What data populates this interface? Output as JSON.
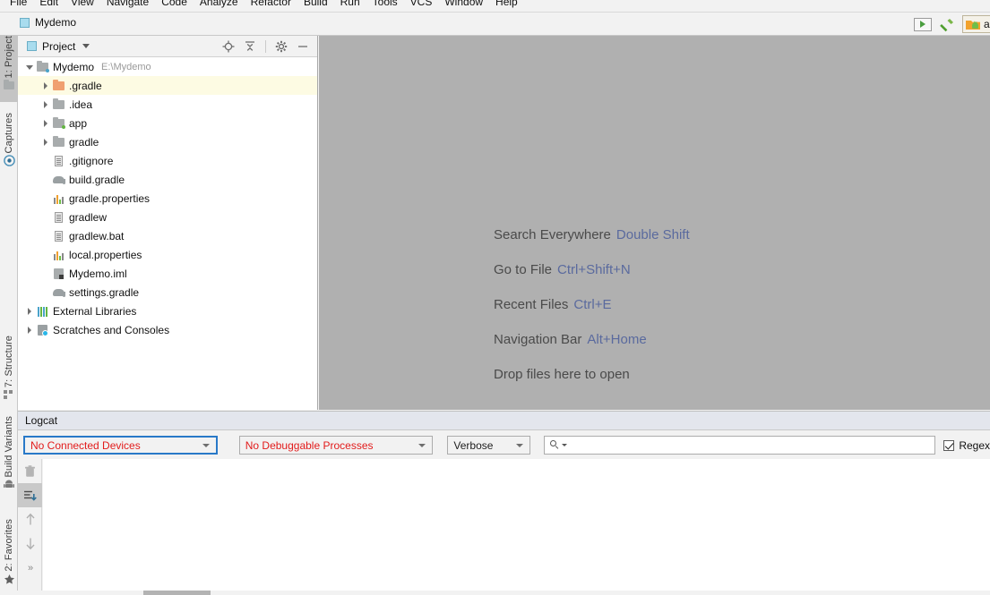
{
  "menu": {
    "items": [
      {
        "label": "File",
        "mnemonic": "F"
      },
      {
        "label": "Edit",
        "mnemonic": "E"
      },
      {
        "label": "View",
        "mnemonic": "V"
      },
      {
        "label": "Navigate",
        "mnemonic": "N"
      },
      {
        "label": "Code",
        "mnemonic": "C"
      },
      {
        "label": "Analyze",
        "mnemonic": "z"
      },
      {
        "label": "Refactor",
        "mnemonic": "R"
      },
      {
        "label": "Build",
        "mnemonic": "B"
      },
      {
        "label": "Run",
        "mnemonic": "u"
      },
      {
        "label": "Tools",
        "mnemonic": "T"
      },
      {
        "label": "VCS",
        "mnemonic": "S"
      },
      {
        "label": "Window",
        "mnemonic": "W"
      },
      {
        "label": "Help",
        "mnemonic": "H"
      }
    ]
  },
  "toolbar": {
    "project_name": "Mydemo",
    "run_config_icon": "run-triangle-icon",
    "build_icon": "hammer-icon",
    "module_chip_label": "app",
    "module_chip_icon": "android-module-icon"
  },
  "left_strip": {
    "top_buttons": [
      {
        "label": "1: Project",
        "icon": "project-folder-icon",
        "active": true
      },
      {
        "label": "Captures",
        "icon": "captures-target-icon",
        "active": false
      }
    ],
    "bottom_buttons": [
      {
        "label": "7: Structure",
        "icon": "structure-icon",
        "active": false
      },
      {
        "label": "Build Variants",
        "icon": "android-icon",
        "active": false
      },
      {
        "label": "2: Favorites",
        "icon": "star-icon",
        "active": false
      }
    ]
  },
  "project_panel": {
    "title": "Project",
    "title_icon": "project-square-icon",
    "actions": [
      {
        "name": "locate-icon"
      },
      {
        "name": "collapse-all-icon"
      },
      {
        "name": "gear-icon"
      },
      {
        "name": "minimize-icon"
      }
    ],
    "tree": [
      {
        "label": "Mydemo",
        "detail": "E:\\Mydemo",
        "indent": 0,
        "arrow": "open",
        "icon": "module-folder-icon",
        "highlight": false
      },
      {
        "label": ".gradle",
        "detail": "",
        "indent": 1,
        "arrow": "closed",
        "icon": "folder-orange-icon",
        "highlight": true
      },
      {
        "label": ".idea",
        "detail": "",
        "indent": 1,
        "arrow": "closed",
        "icon": "folder-grey-icon",
        "highlight": false
      },
      {
        "label": "app",
        "detail": "",
        "indent": 1,
        "arrow": "closed",
        "icon": "folder-module-icon",
        "highlight": false
      },
      {
        "label": "gradle",
        "detail": "",
        "indent": 1,
        "arrow": "closed",
        "icon": "folder-grey-icon",
        "highlight": false
      },
      {
        "label": ".gitignore",
        "detail": "",
        "indent": 1,
        "arrow": "none",
        "icon": "text-file-icon",
        "highlight": false
      },
      {
        "label": "build.gradle",
        "detail": "",
        "indent": 1,
        "arrow": "none",
        "icon": "gradle-file-icon",
        "highlight": false
      },
      {
        "label": "gradle.properties",
        "detail": "",
        "indent": 1,
        "arrow": "none",
        "icon": "properties-file-icon",
        "highlight": false
      },
      {
        "label": "gradlew",
        "detail": "",
        "indent": 1,
        "arrow": "none",
        "icon": "text-file-icon",
        "highlight": false
      },
      {
        "label": "gradlew.bat",
        "detail": "",
        "indent": 1,
        "arrow": "none",
        "icon": "text-file-icon",
        "highlight": false
      },
      {
        "label": "local.properties",
        "detail": "",
        "indent": 1,
        "arrow": "none",
        "icon": "properties-file-icon",
        "highlight": false
      },
      {
        "label": "Mydemo.iml",
        "detail": "",
        "indent": 1,
        "arrow": "none",
        "icon": "iml-file-icon",
        "highlight": false
      },
      {
        "label": "settings.gradle",
        "detail": "",
        "indent": 1,
        "arrow": "none",
        "icon": "gradle-file-icon",
        "highlight": false
      },
      {
        "label": "External Libraries",
        "detail": "",
        "indent": 0,
        "arrow": "closed",
        "icon": "library-icon",
        "highlight": false
      },
      {
        "label": "Scratches and Consoles",
        "detail": "",
        "indent": 0,
        "arrow": "closed",
        "icon": "scratches-icon",
        "highlight": false
      }
    ]
  },
  "editor": {
    "hints": [
      {
        "action": "Search Everywhere",
        "shortcut": "Double Shift"
      },
      {
        "action": "Go to File",
        "shortcut": "Ctrl+Shift+N"
      },
      {
        "action": "Recent Files",
        "shortcut": "Ctrl+E"
      },
      {
        "action": "Navigation Bar",
        "shortcut": "Alt+Home"
      },
      {
        "action": "Drop files here to open",
        "shortcut": ""
      }
    ]
  },
  "logcat": {
    "tab_label": "Logcat",
    "device_select": {
      "value": "No Connected Devices",
      "state": "error",
      "focused": true
    },
    "process_select": {
      "value": "No Debuggable Processes",
      "state": "error",
      "focused": false
    },
    "level_select": {
      "value": "Verbose",
      "state": "normal",
      "focused": false
    },
    "search": {
      "value": "",
      "placeholder": "",
      "icon": "search-icon"
    },
    "regex": {
      "label": "Regex",
      "checked": true
    },
    "side_buttons": [
      {
        "name": "clear-logcat-icon",
        "selected": false
      },
      {
        "name": "scroll-to-end-icon",
        "selected": true
      },
      {
        "name": "up-arrow-icon",
        "selected": false
      },
      {
        "name": "down-arrow-icon",
        "selected": false
      },
      {
        "name": "expand-more-icon",
        "selected": false
      }
    ],
    "content": ""
  },
  "colors": {
    "accent_blue": "#2979c8",
    "error_red": "#e21b1b",
    "shortcut_blue": "#5a6a9e",
    "highlight_yellow": "#fdfbe3",
    "editor_grey": "#b0b0b0"
  }
}
